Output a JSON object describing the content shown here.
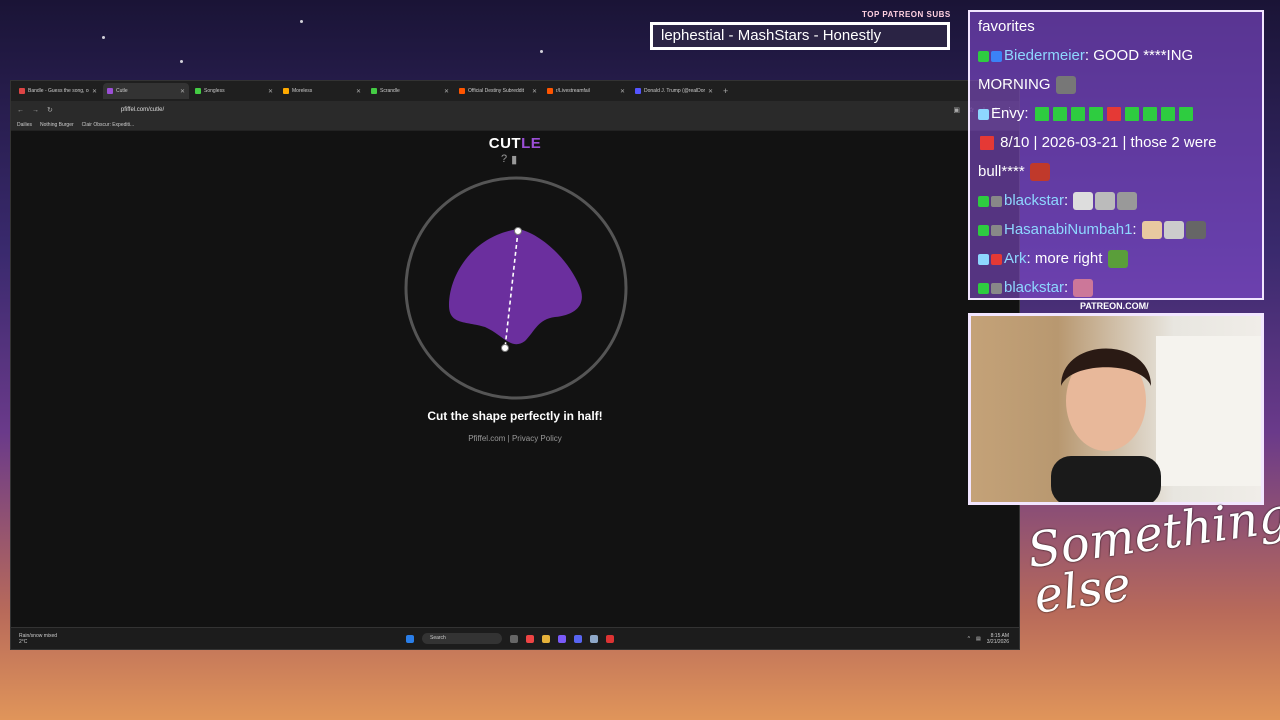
{
  "overlay": {
    "stream_title": "lephestial - MashStars - Honestly",
    "patreon_label": "TOP PATREON SUBS",
    "patreon_url": "PATREON.COM/",
    "logo_text": "Something else"
  },
  "browser": {
    "tabs": [
      {
        "label": "Bandle - Guess the song, one ins...",
        "color": "#d44"
      },
      {
        "label": "Cutle",
        "color": "#9b4fd6",
        "active": true
      },
      {
        "label": "Songless",
        "color": "#4c4"
      },
      {
        "label": "Moreless",
        "color": "#fa0"
      },
      {
        "label": "Scrandle",
        "color": "#4c4"
      },
      {
        "label": "Official Destiny Subreddit",
        "color": "#f50"
      },
      {
        "label": "r/Livestreamfail",
        "color": "#f50"
      },
      {
        "label": "Donald J. Trump (@realDonaldT...",
        "color": "#55f"
      }
    ],
    "url": "pfiffel.com/cutle/",
    "bookmarks": [
      "Dailies",
      "Nothing Burger",
      "Clair Obscur: Expediti..."
    ]
  },
  "game": {
    "title_a": "CUT",
    "title_b": "LE",
    "instruction": "Cut the shape perfectly in half!",
    "footer_site": "Pfiffel.com",
    "footer_sep": "|",
    "footer_privacy": "Privacy Policy",
    "shape_color": "#6b2f9e"
  },
  "taskbar": {
    "weather_line1": "Rain/snow mixed",
    "weather_line2": "2°C",
    "search": "Search",
    "time": "8:15 AM",
    "date": "3/21/2026"
  },
  "chat": {
    "messages": [
      {
        "user": "",
        "text": "favorites"
      },
      {
        "user": "Biedermeier",
        "text": ": GOOD ****ING MORNING"
      },
      {
        "user": "Envy",
        "text": ":"
      },
      {
        "user": "",
        "text": "8/10 | 2026-03-21 | those 2 were bull****"
      },
      {
        "user": "blackstar",
        "text": ":"
      },
      {
        "user": "HasanabiNumbah1",
        "text": ":"
      },
      {
        "user": "Ark",
        "text": ": more right"
      },
      {
        "user": "blackstar",
        "text": ":"
      }
    ],
    "envy_squares": [
      "#2ecc40",
      "#2ecc40",
      "#2ecc40",
      "#2ecc40",
      "#e53935",
      "#2ecc40",
      "#2ecc40",
      "#2ecc40",
      "#2ecc40",
      "#2ecc40",
      "#e53935"
    ]
  }
}
